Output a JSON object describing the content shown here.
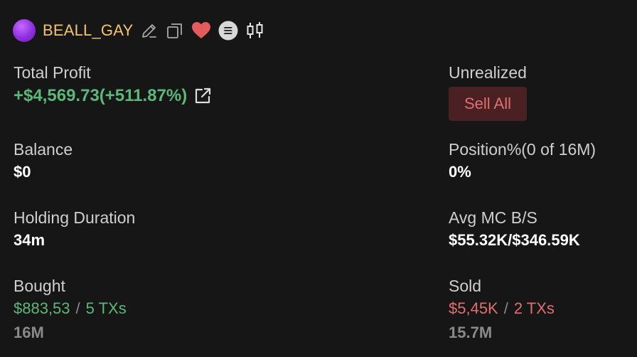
{
  "token": {
    "name": "BEALL_GAY",
    "avatar_color": "#9b3ff0",
    "name_color": "#f2c46d",
    "icons": [
      "edit-icon",
      "copy-icon",
      "heart-icon",
      "solana-icon",
      "candlestick-chart-icon"
    ]
  },
  "total_profit": {
    "label": "Total Profit",
    "value": "+$4,569.73(+511.87%)",
    "color": "#5cb87a"
  },
  "unrealized": {
    "label": "Unrealized",
    "sell_all_label": "Sell All"
  },
  "balance": {
    "label": "Balance",
    "value": "$0"
  },
  "position": {
    "label": "Position%(0 of 16M)",
    "value": "0%"
  },
  "holding_duration": {
    "label": "Holding Duration",
    "value": "34m"
  },
  "avg_mc": {
    "label": "Avg MC B/S",
    "value": "$55.32K/$346.59K"
  },
  "bought": {
    "label": "Bought",
    "amount": "$883,53",
    "separator": "/",
    "txs": "5 TXs",
    "mcap": "16M"
  },
  "sold": {
    "label": "Sold",
    "amount": "$5,45K",
    "separator": "/",
    "txs": "2 TXs",
    "mcap": "15.7M"
  },
  "colors": {
    "background": "#161616",
    "positive": "#5cb87a",
    "negative": "#e07070",
    "sell_button_bg": "#4a2023"
  }
}
